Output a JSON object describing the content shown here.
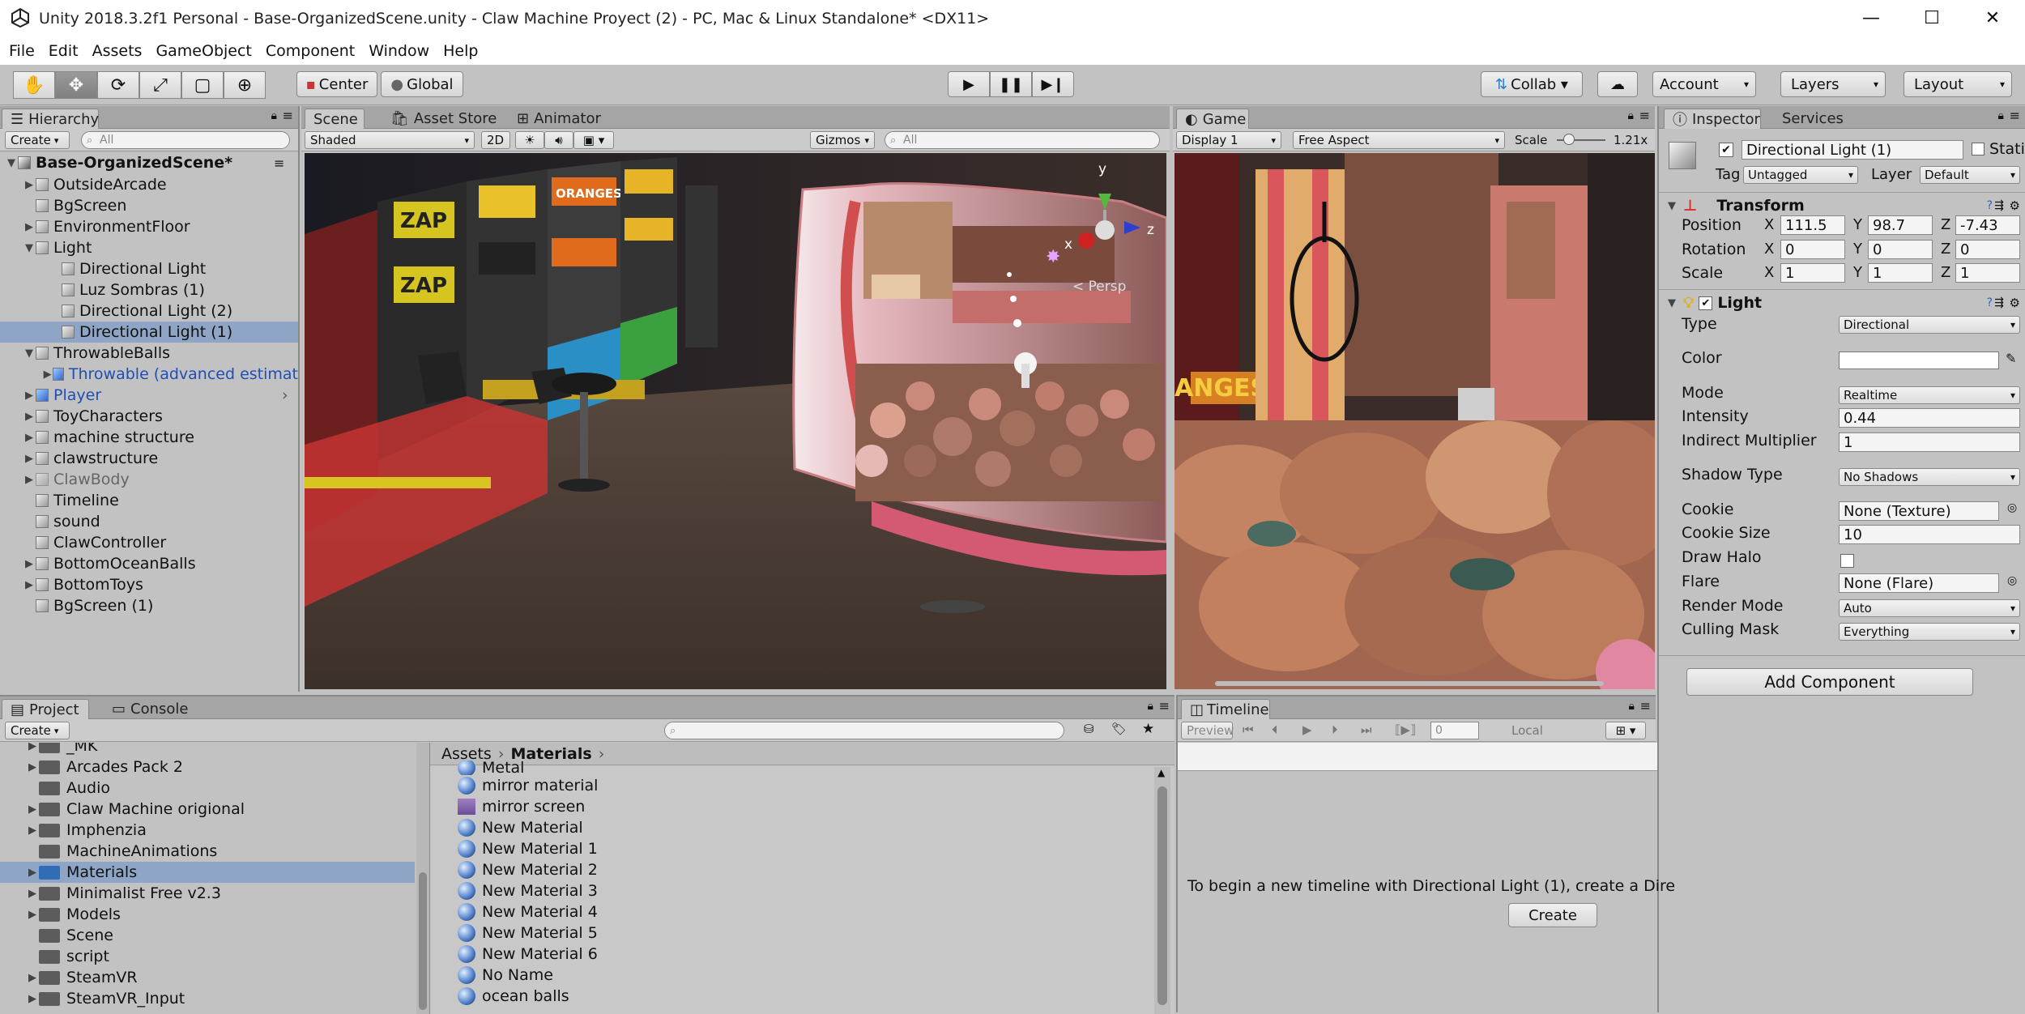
{
  "window": {
    "title": "Unity 2018.3.2f1 Personal - Base-OrganizedScene.unity - Claw Machine Proyect (2) - PC, Mac & Linux Standalone* <DX11>",
    "minimize": "—",
    "maximize": "☐",
    "close": "✕"
  },
  "menu": [
    "File",
    "Edit",
    "Assets",
    "GameObject",
    "Component",
    "Window",
    "Help"
  ],
  "toolbar": {
    "center": "Center",
    "global": "Global",
    "collab": "Collab ▾",
    "account": "Account",
    "layers": "Layers",
    "layout": "Layout"
  },
  "hierarchy": {
    "tab": "Hierarchy",
    "create": "Create",
    "search": "All",
    "scene": "Base-OrganizedScene*",
    "items": [
      {
        "label": "OutsideArcade"
      },
      {
        "label": "BgScreen"
      },
      {
        "label": "EnvironmentFloor"
      },
      {
        "label": "Light"
      },
      {
        "label": "Directional Light"
      },
      {
        "label": "Luz Sombras (1)"
      },
      {
        "label": "Directional Light (2)"
      },
      {
        "label": "Directional Light (1)"
      },
      {
        "label": "ThrowableBalls"
      },
      {
        "label": "Throwable (advanced estimat"
      },
      {
        "label": "Player"
      },
      {
        "label": "ToyCharacters"
      },
      {
        "label": "machine structure"
      },
      {
        "label": "clawstructure"
      },
      {
        "label": "ClawBody"
      },
      {
        "label": "Timeline"
      },
      {
        "label": "sound"
      },
      {
        "label": "ClawController"
      },
      {
        "label": "BottomOceanBalls"
      },
      {
        "label": "BottomToys"
      },
      {
        "label": "BgScreen (1)"
      }
    ]
  },
  "scene": {
    "tabs": [
      "Scene",
      "Asset Store",
      "Animator"
    ],
    "shaded": "Shaded",
    "twod": "2D",
    "gizmos": "Gizmos",
    "search": "All",
    "persp": "< Persp",
    "y": "y",
    "x": "x",
    "z": "z"
  },
  "game": {
    "tab": "Game",
    "display": "Display 1",
    "aspect": "Free Aspect",
    "scale_label": "Scale",
    "scale_value": "1.21x"
  },
  "inspector": {
    "tabs": [
      "Inspector",
      "Services"
    ],
    "object_name": "Directional Light (1)",
    "static": "Static",
    "tag_label": "Tag",
    "tag": "Untagged",
    "layer_label": "Layer",
    "layer": "Default",
    "transform": {
      "title": "Transform",
      "position": "Position",
      "rotation": "Rotation",
      "scale": "Scale",
      "x": "X",
      "y": "Y",
      "z": "Z",
      "pos": [
        "111.5",
        "98.7",
        "-7.43"
      ],
      "rot": [
        "0",
        "0",
        "0"
      ],
      "scl": [
        "1",
        "1",
        "1"
      ]
    },
    "light": {
      "title": "Light",
      "type_label": "Type",
      "type": "Directional",
      "color_label": "Color",
      "mode_label": "Mode",
      "mode": "Realtime",
      "intensity_label": "Intensity",
      "intensity": "0.44",
      "indirect_label": "Indirect Multiplier",
      "indirect": "1",
      "shadow_label": "Shadow Type",
      "shadow": "No Shadows",
      "cookie_label": "Cookie",
      "cookie": "None (Texture)",
      "cookie_size_label": "Cookie Size",
      "cookie_size": "10",
      "halo_label": "Draw Halo",
      "flare_label": "Flare",
      "flare": "None (Flare)",
      "render_label": "Render Mode",
      "render": "Auto",
      "culling_label": "Culling Mask",
      "culling": "Everything"
    },
    "add_component": "Add Component"
  },
  "project": {
    "tabs": [
      "Project",
      "Console"
    ],
    "create": "Create",
    "breadcrumb": [
      "Assets",
      "Materials"
    ],
    "folders": [
      {
        "label": "_MK"
      },
      {
        "label": "Arcades Pack 2"
      },
      {
        "label": "Audio"
      },
      {
        "label": "Claw Machine origional"
      },
      {
        "label": "Imphenzia"
      },
      {
        "label": "MachineAnimations"
      },
      {
        "label": "Materials"
      },
      {
        "label": "Minimalist Free v2.3"
      },
      {
        "label": "Models"
      },
      {
        "label": "Scene"
      },
      {
        "label": "script"
      },
      {
        "label": "SteamVR"
      },
      {
        "label": "SteamVR_Input"
      }
    ],
    "files": [
      {
        "label": "Metal"
      },
      {
        "label": "mirror material"
      },
      {
        "label": "mirror screen"
      },
      {
        "label": "New Material"
      },
      {
        "label": "New Material 1"
      },
      {
        "label": "New Material 2"
      },
      {
        "label": "New Material 3"
      },
      {
        "label": "New Material 4"
      },
      {
        "label": "New Material 5"
      },
      {
        "label": "New Material 6"
      },
      {
        "label": "No Name"
      },
      {
        "label": "ocean balls"
      }
    ]
  },
  "timeline": {
    "tab": "Timeline",
    "preview": "Preview",
    "frame": "0",
    "local": "Local",
    "message": "To begin a new timeline with Directional Light (1), create a Dire",
    "create": "Create"
  }
}
